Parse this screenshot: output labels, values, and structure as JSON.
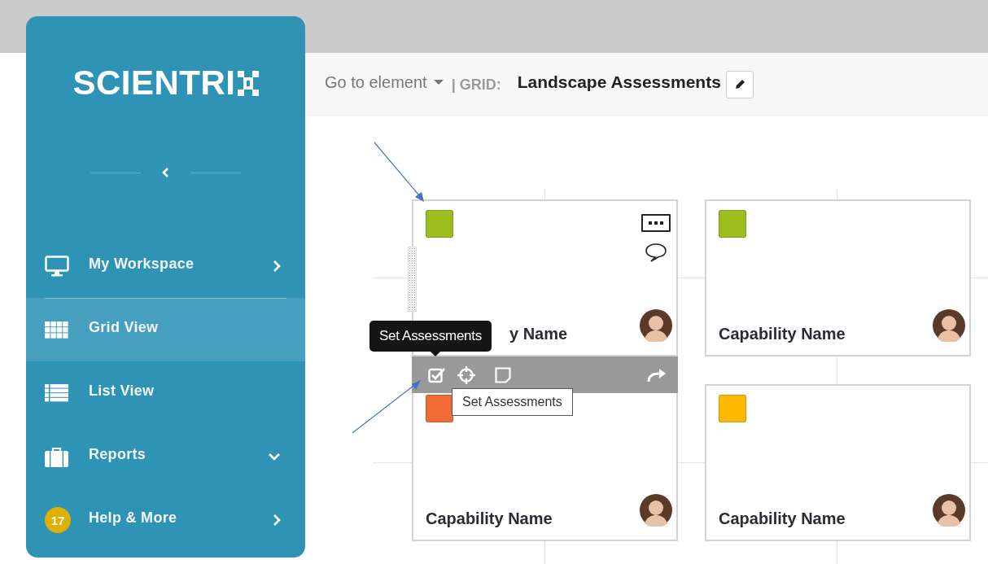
{
  "logo": {
    "text": "SCIENTRI"
  },
  "nav": [
    {
      "label": "My Workspace",
      "kind": "workspace",
      "submenu": true,
      "selected": false
    },
    {
      "label": "Grid View",
      "kind": "grid",
      "submenu": false,
      "selected": true
    },
    {
      "label": "List View",
      "kind": "list",
      "submenu": false,
      "selected": false
    },
    {
      "label": "Reports",
      "kind": "reports",
      "submenu": true,
      "expanded": false,
      "selected": false
    },
    {
      "label": "Help & More",
      "kind": "help",
      "badge": "17",
      "submenu": true,
      "selected": false
    }
  ],
  "header": {
    "goto": "Go to element",
    "grid_label": "| GRID:",
    "grid_name": "Landscape Assessments"
  },
  "cards": [
    {
      "title": "y Name",
      "color": "#9dbe1f",
      "actions": true,
      "toolbar": {
        "tooltip": "Set Assessments",
        "hint": "Set Assessments"
      }
    },
    {
      "title": "Capability Name",
      "color": "#9dbe1f",
      "actions": false
    },
    {
      "title": "Capability Name",
      "color": "#f26a35",
      "actions": false
    },
    {
      "title": "Capability Name",
      "color": "#ffb900",
      "actions": false
    }
  ]
}
